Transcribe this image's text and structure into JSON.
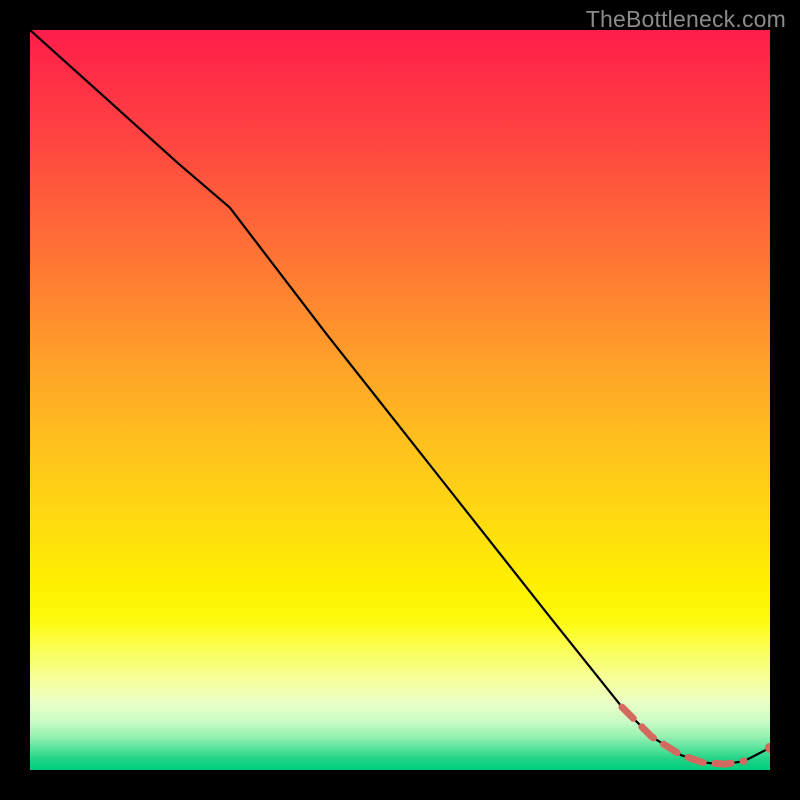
{
  "watermark": "TheBottleneck.com",
  "colors": {
    "background": "#000000",
    "curve": "#000000",
    "dashed": "#d46a5f",
    "gradient_top": "#ff1d4b",
    "gradient_mid": "#ffe40a",
    "gradient_bottom": "#00cc7d"
  },
  "chart_data": {
    "type": "line",
    "title": "",
    "xlabel": "",
    "ylabel": "",
    "xlim": [
      0,
      100
    ],
    "ylim": [
      0,
      100
    ],
    "series": [
      {
        "name": "main_curve",
        "x": [
          0,
          10,
          20,
          27,
          40,
          55,
          70,
          80,
          84,
          88,
          91,
          94,
          96.5,
          100
        ],
        "y": [
          100,
          91,
          82,
          76,
          59,
          40,
          21,
          8.5,
          4.5,
          2,
          1,
          0.8,
          1.2,
          3
        ]
      },
      {
        "name": "dashed_overlay",
        "x": [
          80,
          84,
          88,
          91,
          94,
          96.5
        ],
        "y": [
          8.5,
          4.5,
          2,
          1,
          0.8,
          1.2
        ]
      }
    ],
    "end_marker": {
      "x": 100,
      "y": 3
    }
  }
}
